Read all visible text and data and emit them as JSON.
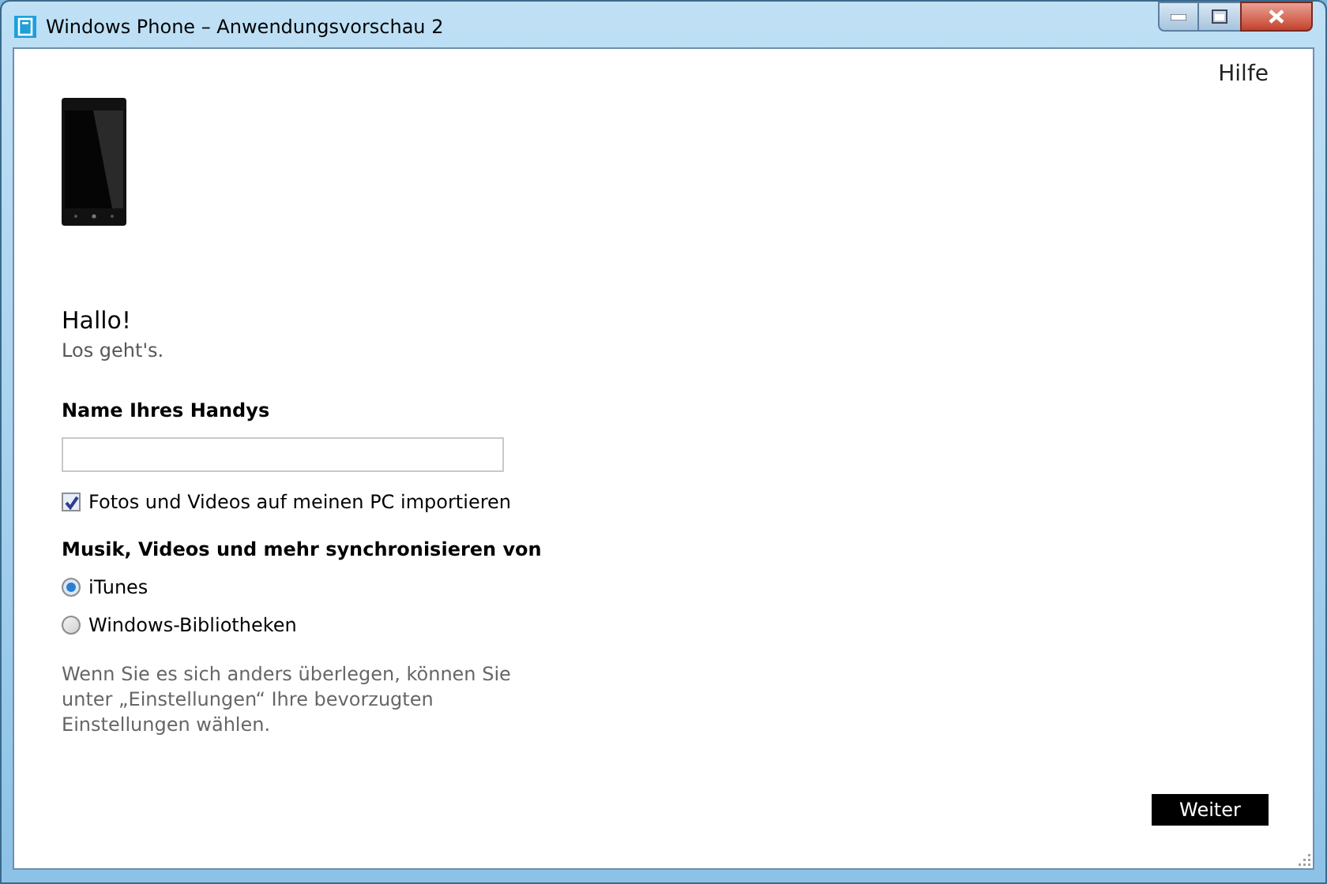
{
  "window": {
    "title": "Windows Phone – Anwendungsvorschau 2"
  },
  "help_link": "Hilfe",
  "greeting": {
    "title": "Hallo!",
    "subtitle": "Los geht's."
  },
  "phone_name": {
    "label": "Name Ihres Handys"
  },
  "import_option": {
    "label": "Fotos und Videos auf meinen PC importieren",
    "checked": true
  },
  "sync": {
    "heading": "Musik, Videos und mehr synchronisieren von",
    "options": [
      {
        "label": "iTunes",
        "selected": true
      },
      {
        "label": "Windows-Bibliotheken",
        "selected": false
      }
    ]
  },
  "note": "Wenn Sie es sich anders überlegen, können Sie unter „Einstellungen“ Ihre bevorzugten Einstellungen wählen.",
  "next_button": "Weiter"
}
